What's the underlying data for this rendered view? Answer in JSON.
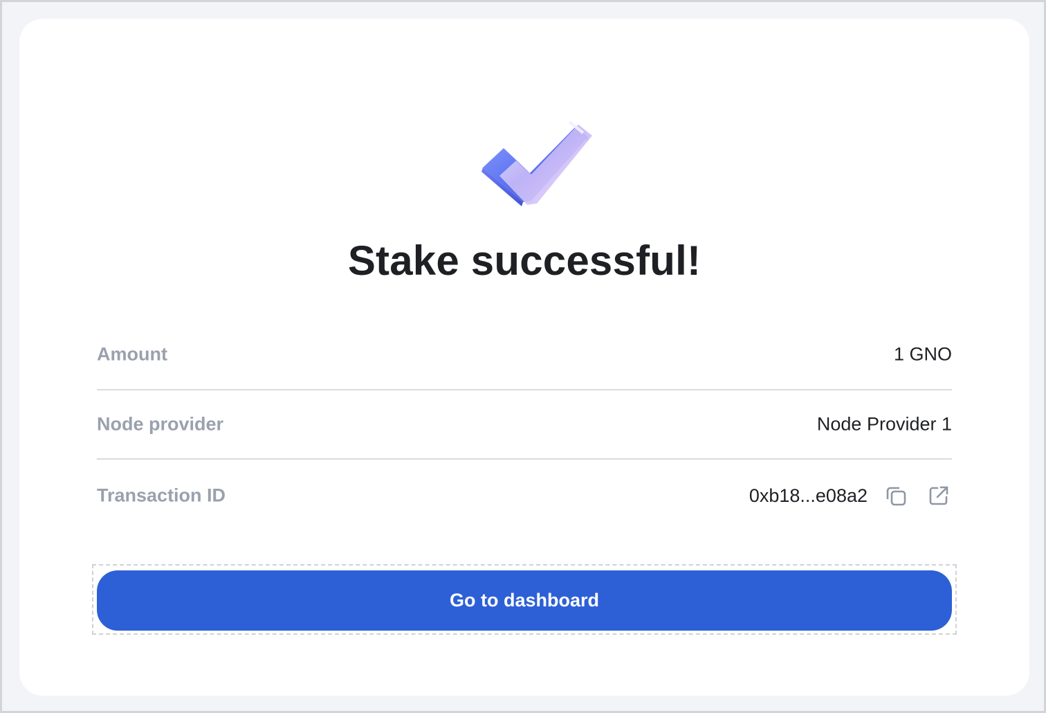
{
  "icons": {
    "hero": "checkmark-icon",
    "copy": "copy-icon",
    "external": "external-link-icon"
  },
  "colors": {
    "accent": "#2d60d6",
    "title": "#1e2024",
    "label": "#9aa1ad",
    "divider": "#d9dbde"
  },
  "title": "Stake successful!",
  "details": {
    "amount": {
      "label": "Amount",
      "value": "1 GNO"
    },
    "node_provider": {
      "label": "Node provider",
      "value": "Node Provider 1"
    },
    "transaction": {
      "label": "Transaction ID",
      "value": "0xb18...e08a2"
    }
  },
  "cta": {
    "label": "Go to dashboard"
  }
}
